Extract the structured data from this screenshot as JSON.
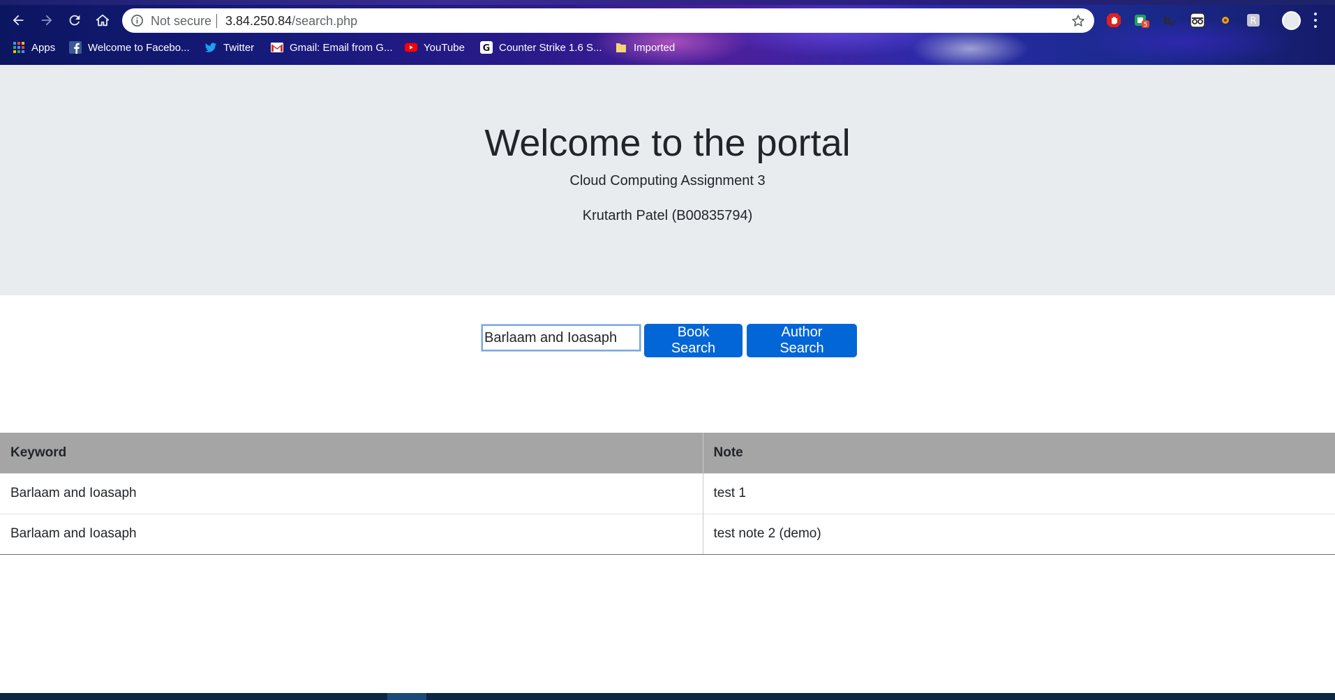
{
  "browser": {
    "security_label": "Not secure",
    "url_host": "3.84.250.84",
    "url_path": "/search.php",
    "bookmarks": [
      {
        "label": "Apps",
        "icon": "apps-grid-icon"
      },
      {
        "label": "Welcome to Facebo...",
        "icon": "facebook-icon"
      },
      {
        "label": "Twitter",
        "icon": "twitter-icon"
      },
      {
        "label": "Gmail: Email from G...",
        "icon": "gmail-icon"
      },
      {
        "label": "YouTube",
        "icon": "youtube-icon"
      },
      {
        "label": "Counter Strike 1.6 S...",
        "icon": "counter-strike-icon"
      },
      {
        "label": "Imported",
        "icon": "folder-icon"
      }
    ],
    "extension_badge": "5"
  },
  "header": {
    "title": "Welcome to the portal",
    "subtitle": "Cloud Computing Assignment 3",
    "author": "Krutarth Patel (B00835794)"
  },
  "search": {
    "value": "Barlaam and Ioasaph",
    "book_button": "Book Search",
    "author_button": "Author Search"
  },
  "table": {
    "headers": [
      "Keyword",
      "Note"
    ],
    "rows": [
      [
        "Barlaam and Ioasaph",
        "test 1"
      ],
      [
        "Barlaam and Ioasaph",
        "test note 2 (demo)"
      ]
    ]
  },
  "colors": {
    "accent": "#0366d6",
    "jumbotron_bg": "#e9ecef",
    "table_header_bg": "#a5a5a5"
  }
}
